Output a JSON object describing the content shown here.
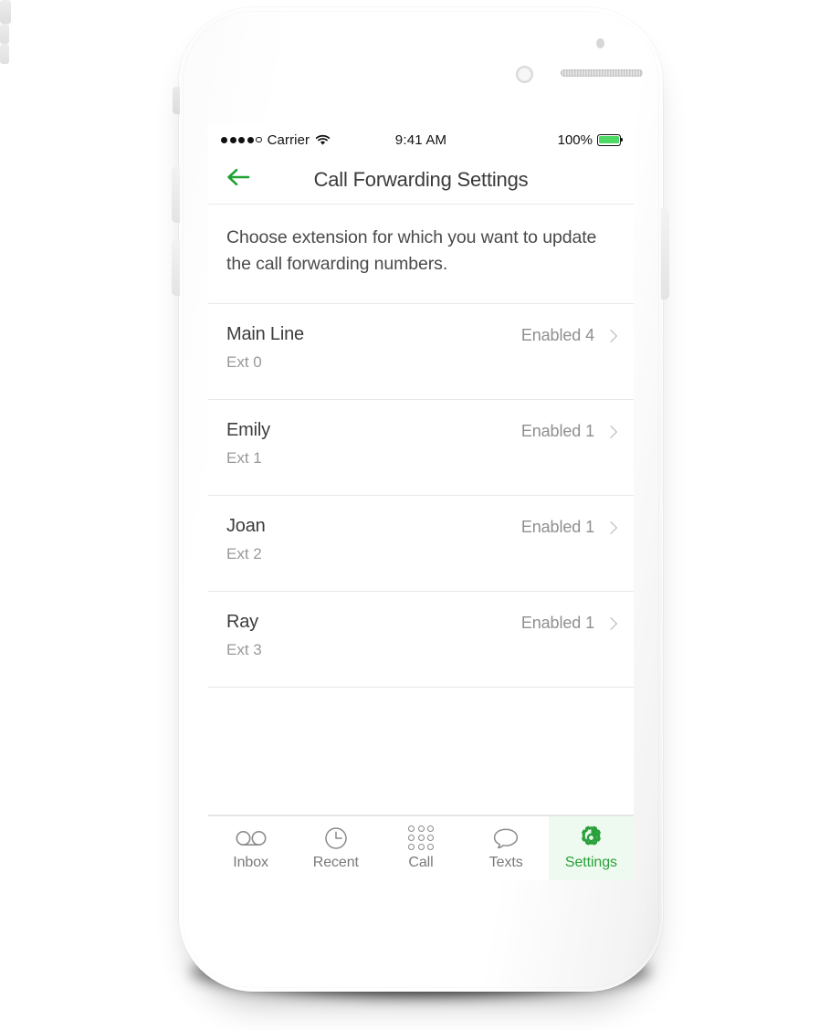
{
  "device": {
    "hardware": {
      "sensor": "proximity-sensor",
      "camera": "front-camera",
      "earpiece": "earpiece-speaker",
      "buttons": [
        "silent-switch",
        "volume-up",
        "volume-down",
        "power"
      ]
    }
  },
  "status_bar": {
    "signal_dots_filled": 4,
    "signal_dots_total": 5,
    "carrier": "Carrier",
    "wifi": "wifi-icon",
    "time": "9:41 AM",
    "battery_percent": "100%",
    "battery_level": 100,
    "battery_color": "#4cd964"
  },
  "nav_bar": {
    "back_label": "back-arrow",
    "title": "Call Forwarding Settings",
    "accent_color": "#2aa03a"
  },
  "description": {
    "text": "Choose extension for which you want to update the call forwarding numbers."
  },
  "extensions": [
    {
      "name": "Main Line",
      "ext": "Ext 0",
      "status": "Enabled 4"
    },
    {
      "name": "Emily",
      "ext": "Ext 1",
      "status": "Enabled 1"
    },
    {
      "name": "Joan",
      "ext": "Ext 2",
      "status": "Enabled 1"
    },
    {
      "name": "Ray",
      "ext": "Ext 3",
      "status": "Enabled 1"
    }
  ],
  "tab_bar": {
    "active_index": 4,
    "active_bg": "#eefaef",
    "active_color": "#2aa03a",
    "inactive_color": "#7a7a7a",
    "items": [
      {
        "label": "Inbox",
        "icon": "voicemail-icon"
      },
      {
        "label": "Recent",
        "icon": "clock-icon"
      },
      {
        "label": "Call",
        "icon": "keypad-icon"
      },
      {
        "label": "Texts",
        "icon": "speech-bubble-icon"
      },
      {
        "label": "Settings",
        "icon": "gear-icon"
      }
    ]
  }
}
